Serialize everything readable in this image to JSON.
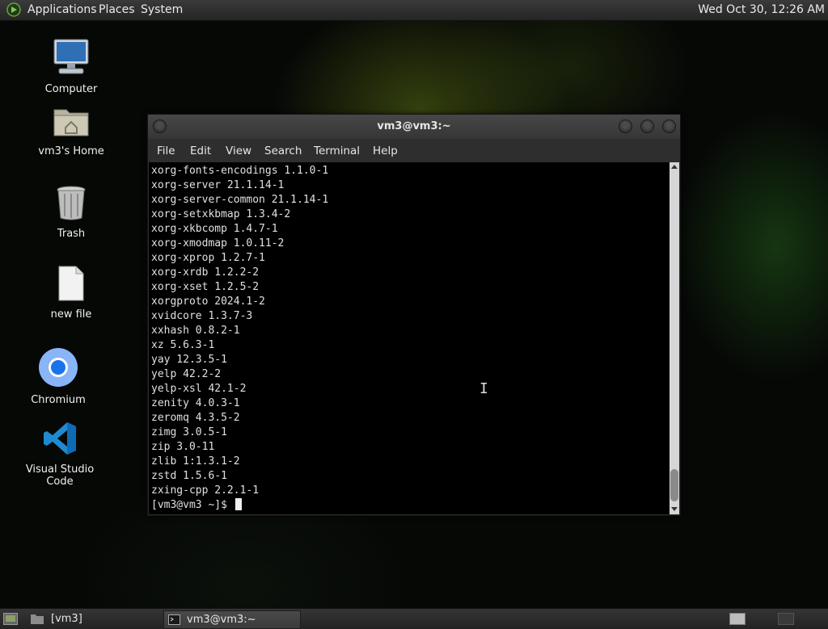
{
  "top_panel": {
    "menus": [
      "Applications",
      "Places",
      "System"
    ],
    "clock": "Wed Oct 30, 12:26 AM"
  },
  "desktop_icons": [
    {
      "label": "Computer",
      "icon": "computer-icon"
    },
    {
      "label": "vm3's Home",
      "icon": "home-folder-icon"
    },
    {
      "label": "Trash",
      "icon": "trash-icon"
    },
    {
      "label": "new file",
      "icon": "file-icon"
    },
    {
      "label": "Chromium",
      "icon": "chromium-icon"
    },
    {
      "label": "Visual Studio Code",
      "icon": "vscode-icon"
    }
  ],
  "terminal": {
    "title": "vm3@vm3:~",
    "menu": [
      "File",
      "Edit",
      "View",
      "Search",
      "Terminal",
      "Help"
    ],
    "lines": [
      "xorg-fonts-encodings 1.1.0-1",
      "xorg-server 21.1.14-1",
      "xorg-server-common 21.1.14-1",
      "xorg-setxkbmap 1.3.4-2",
      "xorg-xkbcomp 1.4.7-1",
      "xorg-xmodmap 1.0.11-2",
      "xorg-xprop 1.2.7-1",
      "xorg-xrdb 1.2.2-2",
      "xorg-xset 1.2.5-2",
      "xorgproto 2024.1-2",
      "xvidcore 1.3.7-3",
      "xxhash 0.8.2-1",
      "xz 5.6.3-1",
      "yay 12.3.5-1",
      "yelp 42.2-2",
      "yelp-xsl 42.1-2",
      "zenity 4.0.3-1",
      "zeromq 4.3.5-2",
      "zimg 3.0.5-1",
      "zip 3.0-11",
      "zlib 1:1.3.1-2",
      "zstd 1.5.6-1",
      "zxing-cpp 2.2.1-1"
    ],
    "prompt": "[vm3@vm3 ~]$ "
  },
  "taskbar": {
    "items": [
      {
        "label": "[vm3]",
        "icon": "folder-icon"
      },
      {
        "label": "vm3@vm3:~",
        "icon": "terminal-icon"
      }
    ]
  }
}
